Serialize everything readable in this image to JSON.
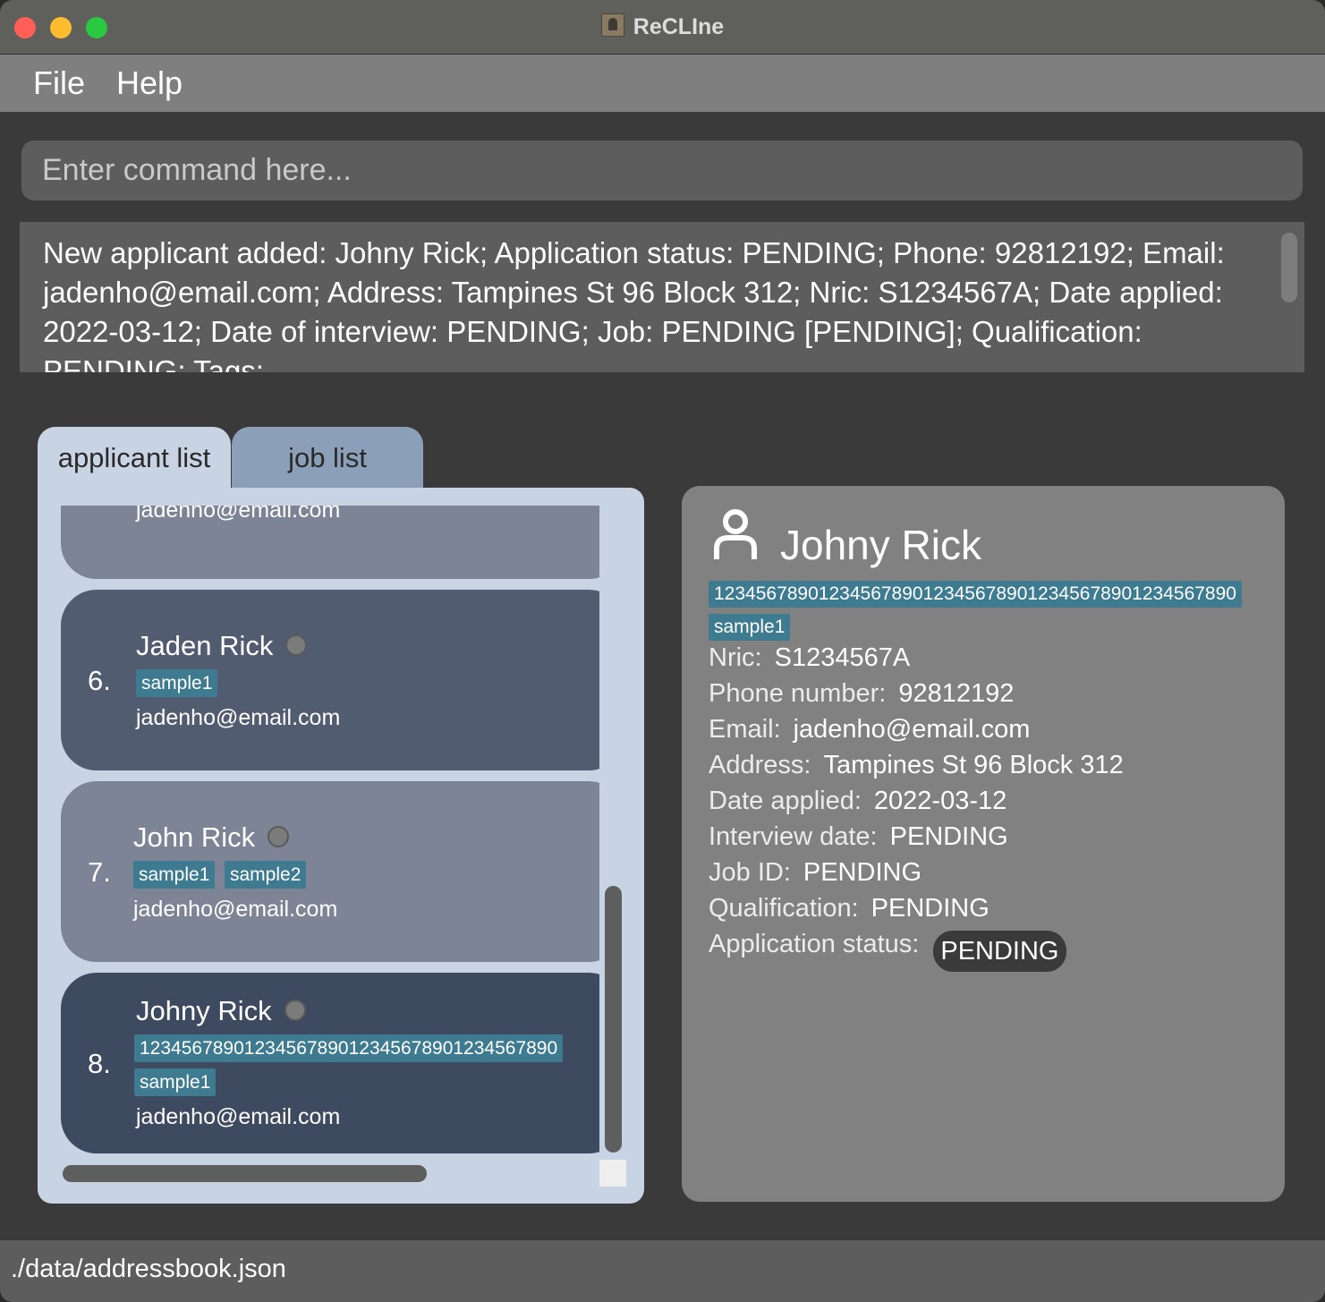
{
  "window": {
    "title": "ReCLIne"
  },
  "menu": {
    "file": "File",
    "help": "Help"
  },
  "command": {
    "placeholder": "Enter command here..."
  },
  "result": {
    "text": "New applicant added: Johny Rick; Application status: PENDING; Phone: 92812192; Email: jadenho@email.com; Address: Tampines St 96 Block 312; Nric: S1234567A; Date applied: 2022-03-12; Date of interview: PENDING; Job: PENDING [PENDING]; Qualification: PENDING; Tags:"
  },
  "tabs": {
    "applicant_list": "applicant list",
    "job_list": "job list"
  },
  "applicants": {
    "partial_email": "jadenho@email.com",
    "items": [
      {
        "index": "6.",
        "name": "Jaden Rick",
        "tags": [
          "sample1"
        ],
        "email": "jadenho@email.com"
      },
      {
        "index": "7.",
        "name": "John Rick",
        "tags": [
          "sample1",
          "sample2"
        ],
        "email": "jadenho@email.com"
      },
      {
        "index": "8.",
        "name": "Johny Rick",
        "tags": [
          "1234567890123456789012345678901234567890",
          "sample1"
        ],
        "email": "jadenho@email.com"
      }
    ]
  },
  "detail": {
    "name": "Johny Rick",
    "tags": [
      "12345678901234567890123456789012345678901234567890",
      "sample1"
    ],
    "nric_label": "Nric:",
    "nric": "S1234567A",
    "phone_label": "Phone number:",
    "phone": "92812192",
    "email_label": "Email:",
    "email": "jadenho@email.com",
    "address_label": "Address:",
    "address": "Tampines St 96 Block 312",
    "date_applied_label": "Date applied:",
    "date_applied": "2022-03-12",
    "interview_label": "Interview date:",
    "interview": "PENDING",
    "job_label": "Job ID:",
    "job": "PENDING",
    "qualification_label": "Qualification:",
    "qualification": "PENDING",
    "status_label": "Application status:",
    "status": "PENDING"
  },
  "statusbar": {
    "path": "./data/addressbook.json"
  },
  "colors": {
    "tag": "#3e7b91",
    "card_6": "#525c70",
    "card_7": "#7d8496",
    "card_8": "#3e4a5f",
    "list_panel": "#c8d3e3",
    "detail_panel": "#818181"
  },
  "icons": {
    "person": "person-outline-icon",
    "app": "contact-book-icon"
  }
}
